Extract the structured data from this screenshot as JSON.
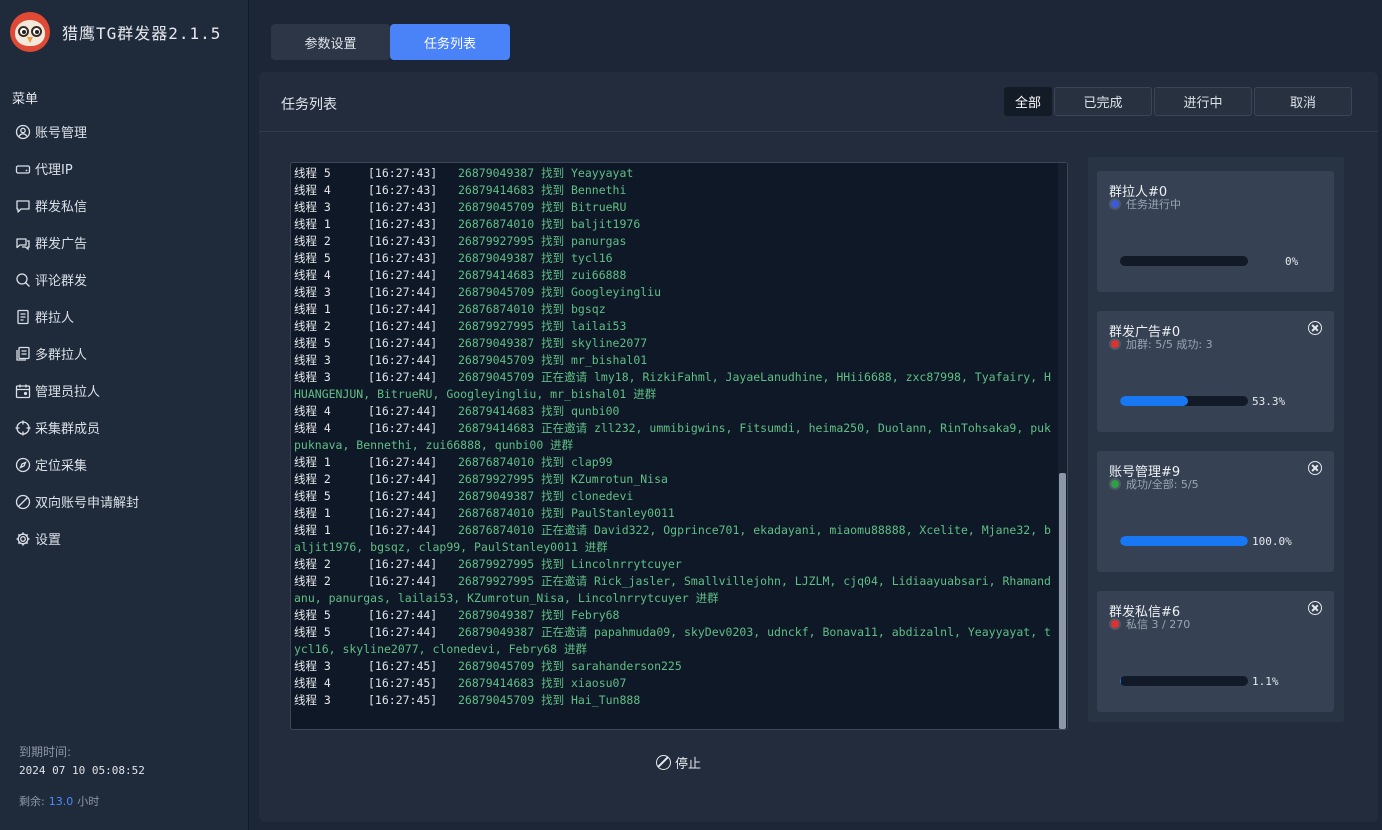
{
  "app": {
    "title": "猎鹰TG群发器2.1.5"
  },
  "sidebar": {
    "heading": "菜单",
    "items": [
      {
        "label": "账号管理",
        "icon": "user-circle-icon"
      },
      {
        "label": "代理IP",
        "icon": "drive-icon"
      },
      {
        "label": "群发私信",
        "icon": "chat-bubble-icon"
      },
      {
        "label": "群发广告",
        "icon": "chat-bubbles-icon"
      },
      {
        "label": "评论群发",
        "icon": "comment-search-icon"
      },
      {
        "label": "群拉人",
        "icon": "document-icon"
      },
      {
        "label": "多群拉人",
        "icon": "documents-icon"
      },
      {
        "label": "管理员拉人",
        "icon": "calendar-user-icon"
      },
      {
        "label": "采集群成员",
        "icon": "crosshair-icon"
      },
      {
        "label": "定位采集",
        "icon": "compass-icon"
      },
      {
        "label": "双向账号申请解封",
        "icon": "ban-icon"
      },
      {
        "label": "设置",
        "icon": "gear-icon"
      }
    ],
    "expire_label": "到期时间:",
    "expire_value": "2024 07 10 05:08:52",
    "remain_label": "剩余:",
    "remain_value": "13.0",
    "remain_unit": "小时"
  },
  "tabs": [
    {
      "label": "参数设置",
      "active": false
    },
    {
      "label": "任务列表",
      "active": true
    }
  ],
  "panel": {
    "title": "任务列表",
    "filters": [
      {
        "label": "全部",
        "active": true
      },
      {
        "label": "已完成",
        "active": false
      },
      {
        "label": "进行中",
        "active": false
      },
      {
        "label": "取消",
        "active": false
      }
    ],
    "stop_label": "停止"
  },
  "log": [
    {
      "thread": "线程 5",
      "time": "[16:27:43]",
      "msg": "26879049387 找到 Yeayyayat"
    },
    {
      "thread": "线程 4",
      "time": "[16:27:43]",
      "msg": "26879414683 找到 Bennethi"
    },
    {
      "thread": "线程 3",
      "time": "[16:27:43]",
      "msg": "26879045709 找到 BitrueRU"
    },
    {
      "thread": "线程 1",
      "time": "[16:27:43]",
      "msg": "26876874010 找到 baljit1976"
    },
    {
      "thread": "线程 2",
      "time": "[16:27:43]",
      "msg": "26879927995 找到 panurgas"
    },
    {
      "thread": "线程 5",
      "time": "[16:27:43]",
      "msg": "26879049387 找到 tycl16"
    },
    {
      "thread": "线程 4",
      "time": "[16:27:44]",
      "msg": "26879414683 找到 zui66888"
    },
    {
      "thread": "线程 3",
      "time": "[16:27:44]",
      "msg": "26879045709 找到 Googleyingliu"
    },
    {
      "thread": "线程 1",
      "time": "[16:27:44]",
      "msg": "26876874010 找到 bgsqz"
    },
    {
      "thread": "线程 2",
      "time": "[16:27:44]",
      "msg": "26879927995 找到 lailai53"
    },
    {
      "thread": "线程 5",
      "time": "[16:27:44]",
      "msg": "26879049387 找到 skyline2077"
    },
    {
      "thread": "线程 3",
      "time": "[16:27:44]",
      "msg": "26879045709 找到 mr_bishal01"
    },
    {
      "thread": "线程 3",
      "time": "[16:27:44]",
      "msg": "26879045709 正在邀请 lmy18, RizkiFahml, JayaeLanudhine, HHii6688, zxc87998, Tyafairy, HHUANGENJUN, BitrueRU, Googleyingliu, mr_bishal01 进群"
    },
    {
      "thread": "线程 4",
      "time": "[16:27:44]",
      "msg": "26879414683 找到 qunbi00"
    },
    {
      "thread": "线程 4",
      "time": "[16:27:44]",
      "msg": "26879414683 正在邀请 zll232, ummibigwins, Fitsumdi, heima250, Duolann, RinTohsaka9, pukpuknava, Bennethi, zui66888, qunbi00 进群"
    },
    {
      "thread": "线程 1",
      "time": "[16:27:44]",
      "msg": "26876874010 找到 clap99"
    },
    {
      "thread": "线程 2",
      "time": "[16:27:44]",
      "msg": "26879927995 找到 KZumrotun_Nisa"
    },
    {
      "thread": "线程 5",
      "time": "[16:27:44]",
      "msg": "26879049387 找到 clonedevi"
    },
    {
      "thread": "线程 1",
      "time": "[16:27:44]",
      "msg": "26876874010 找到 PaulStanley0011"
    },
    {
      "thread": "线程 1",
      "time": "[16:27:44]",
      "msg": "26876874010 正在邀请 David322, Ogprince701, ekadayani, miaomu88888, Xcelite, Mjane32, baljit1976, bgsqz, clap99, PaulStanley0011 进群"
    },
    {
      "thread": "线程 2",
      "time": "[16:27:44]",
      "msg": "26879927995 找到 Lincolnrrytcuyer"
    },
    {
      "thread": "线程 2",
      "time": "[16:27:44]",
      "msg": "26879927995 正在邀请 Rick_jasler, Smallvillejohn, LJZLM, cjq04, Lidiaayuabsari, Rhamandanu, panurgas, lailai53, KZumrotun_Nisa, Lincolnrrytcuyer 进群"
    },
    {
      "thread": "线程 5",
      "time": "[16:27:44]",
      "msg": "26879049387 找到 Febry68"
    },
    {
      "thread": "线程 5",
      "time": "[16:27:44]",
      "msg": "26879049387 正在邀请 papahmuda09, skyDev0203, udnckf, Bonava11, abdizalnl, Yeayyayat, tycl16, skyline2077, clonedevi, Febry68 进群"
    },
    {
      "thread": "线程 3",
      "time": "[16:27:45]",
      "msg": "26879045709 找到 sarahanderson225"
    },
    {
      "thread": "线程 4",
      "time": "[16:27:45]",
      "msg": "26879414683 找到 xiaosu07"
    },
    {
      "thread": "线程 3",
      "time": "[16:27:45]",
      "msg": "26879045709 找到 Hai_Tun888"
    }
  ],
  "tasks": [
    {
      "title": "群拉人#0",
      "status": "任务进行中",
      "dot_color": "#3b5bdb",
      "progress": 0.0,
      "pct_label": "0%",
      "closable": false
    },
    {
      "title": "群发广告#0",
      "status": "加群: 5/5   成功: 3",
      "dot_color": "#e03131",
      "progress": 0.533,
      "pct_label": "53.3%",
      "closable": true
    },
    {
      "title": "账号管理#9",
      "status": "成功/全部: 5/5",
      "dot_color": "#2f9e44",
      "progress": 1.0,
      "pct_label": "100.0%",
      "closable": true
    },
    {
      "title": "群发私信#6",
      "status": "私信 3 / 270",
      "dot_color": "#e03131",
      "progress": 0.011,
      "pct_label": "1.1%",
      "closable": true
    }
  ]
}
